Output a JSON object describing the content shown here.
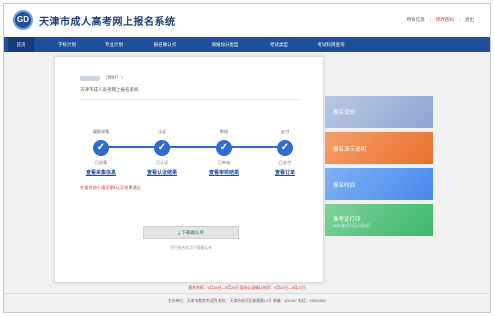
{
  "header": {
    "logo_text": "GD",
    "title": "天津市成人高考网上报名系统",
    "links": [
      "所有信息",
      "修改密码",
      "退出"
    ]
  },
  "nav": {
    "items": [
      "首页",
      "学校计划",
      "专业计划",
      "报名确认点",
      "填报加分类型",
      "考试类型",
      "考试科目查询"
    ]
  },
  "user": {
    "name_masked": "",
    "greeting": "（你好！）",
    "welcome": "天津市成人高考网上报名系统"
  },
  "steps": [
    {
      "title": "填报采集",
      "status": "已采集",
      "link": "查看采集信息"
    },
    {
      "title": "认证",
      "status": "已认证",
      "link": "查看认证结果"
    },
    {
      "title": "审核",
      "status": "已审核",
      "link": "查看审核结果"
    },
    {
      "title": "支付",
      "status": "已支付",
      "link": "查看订单"
    }
  ],
  "warning": "在报名前小请学期1认证结果通过",
  "download": {
    "label": "下载确认单",
    "icon": "download-icon",
    "hint": "您已报名成功下载确认单"
  },
  "side_panels": [
    {
      "label": "报名须知",
      "sub": ""
    },
    {
      "label": "报名演示说明",
      "sub": ""
    },
    {
      "label": "报名时间",
      "sub": ""
    },
    {
      "label": "准考证打印",
      "sub": "2021年9月1日-9月5日"
    }
  ],
  "footer": {
    "period": "报名时间：9月16日—9月20日  现场认证确认时间：9月20日—9月21日",
    "org": "主办单位：天津市教育考试院  地址：天津市南开区复康路10号  邮编：300387 电话：23500552"
  },
  "colors": {
    "brand": "#1f4e9c",
    "step": "#2d6bd1",
    "warning": "#d23c2c"
  }
}
